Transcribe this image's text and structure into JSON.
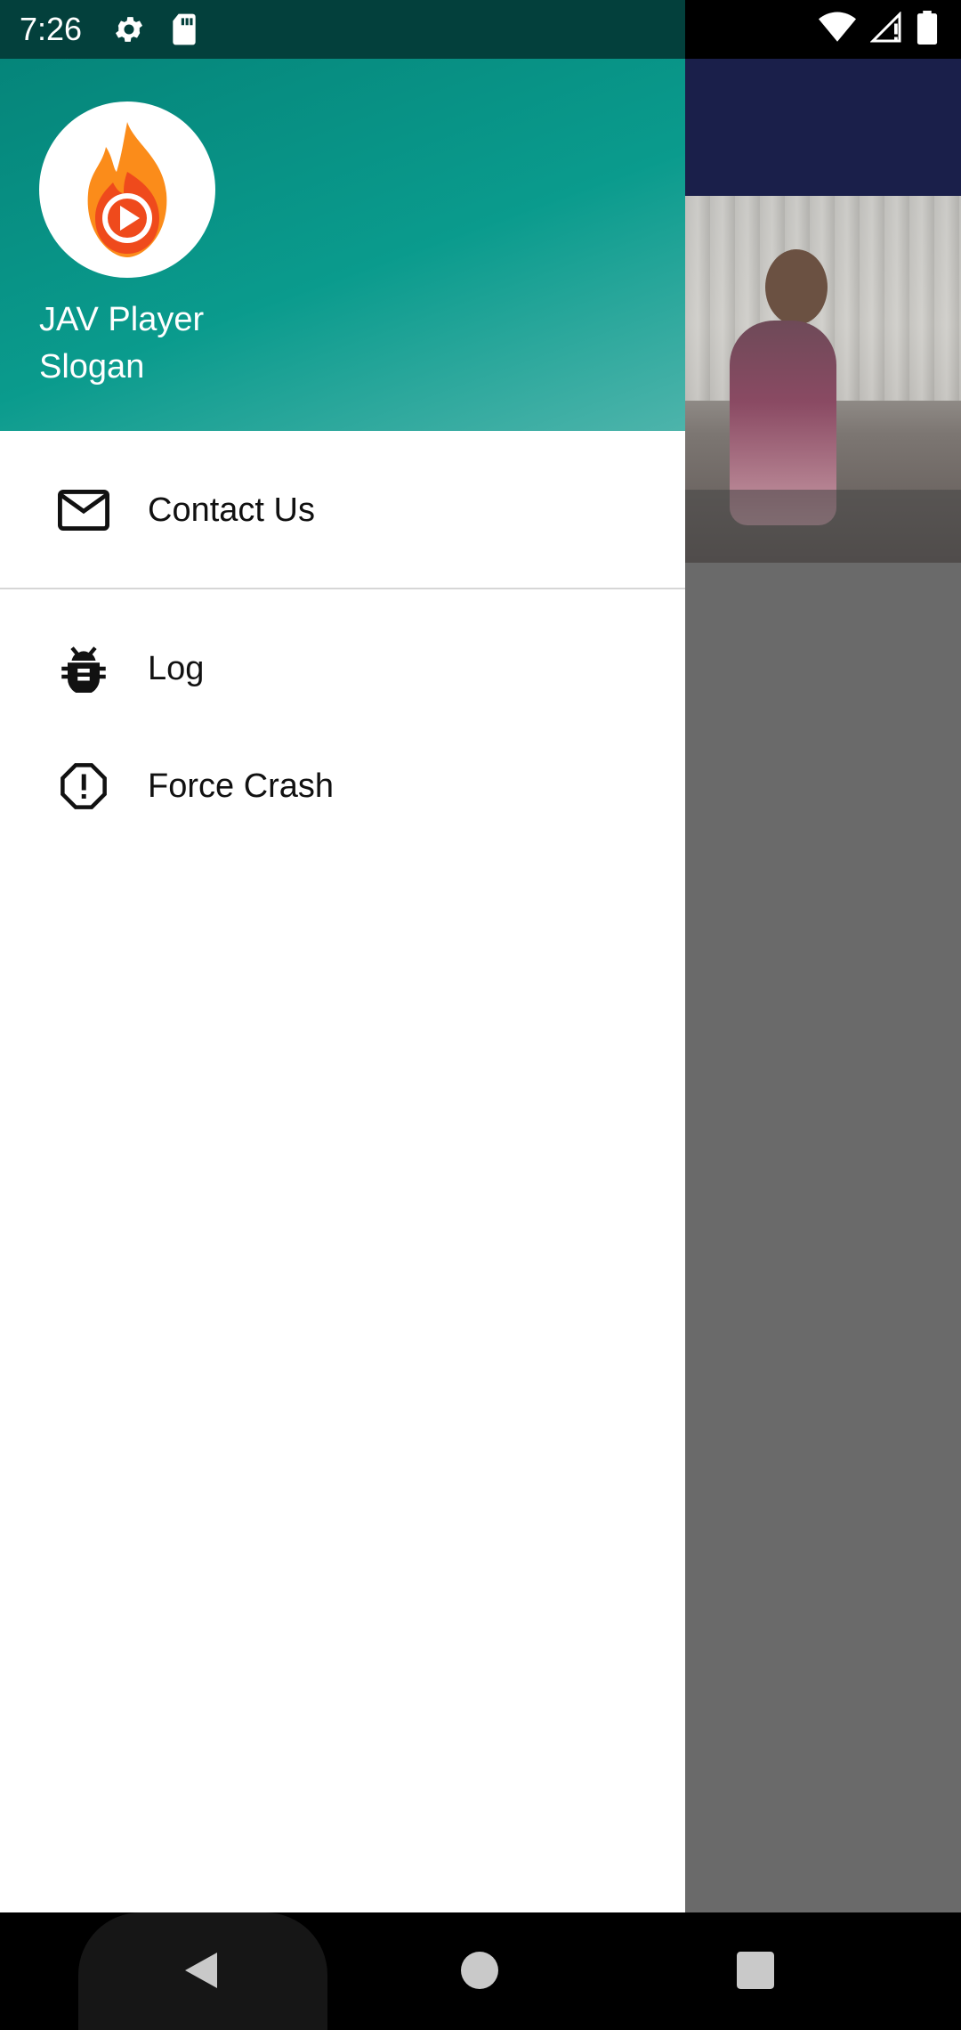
{
  "status_bar": {
    "time": "7:26",
    "left_icons": [
      "gear-icon",
      "sd-card-icon"
    ],
    "right_icons": [
      "wifi-icon",
      "signal-icon",
      "battery-icon"
    ]
  },
  "drawer": {
    "header": {
      "title": "JAV Player",
      "subtitle": "Slogan",
      "logo": "flame-play-logo",
      "gradient_start": "#05857a",
      "gradient_end": "#4db4ab"
    },
    "items": [
      {
        "label": "Contact Us",
        "icon": "mail-icon"
      },
      {
        "label": "Log",
        "icon": "bug-icon"
      },
      {
        "label": "Force Crash",
        "icon": "error-octagon-icon"
      }
    ]
  },
  "nav_bar": {
    "buttons": [
      "back-icon",
      "home-icon",
      "recents-icon"
    ]
  },
  "colors": {
    "toolbar": "#1a1f4a",
    "scrim": "#6a6a6a",
    "accent": "#0a9b8d"
  }
}
